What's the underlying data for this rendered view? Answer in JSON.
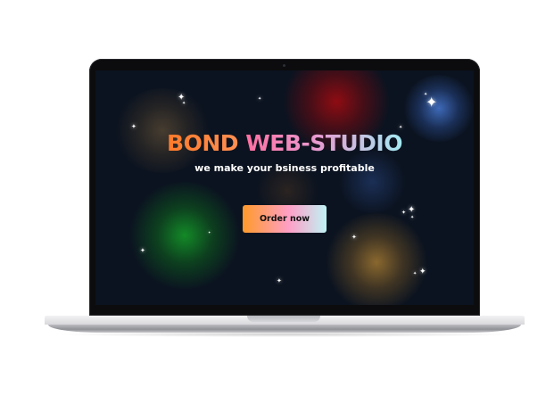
{
  "site": {
    "title_part1": "BOND",
    "title_part2": "WEB-STUDIO",
    "subtitle": "we make your bsiness profitable",
    "cta_label": "Order now"
  },
  "colors": {
    "background": "#0b1320",
    "title_orange": "#ff7a2a",
    "title_pink": "#ff6fa0",
    "title_cyan": "#a4eaf2",
    "button_gradient_start": "#ff9a2a",
    "button_gradient_mid": "#ff9fc6",
    "button_gradient_end": "#bff3f5"
  },
  "icons": {
    "decor": "sparkle-star-icon"
  }
}
